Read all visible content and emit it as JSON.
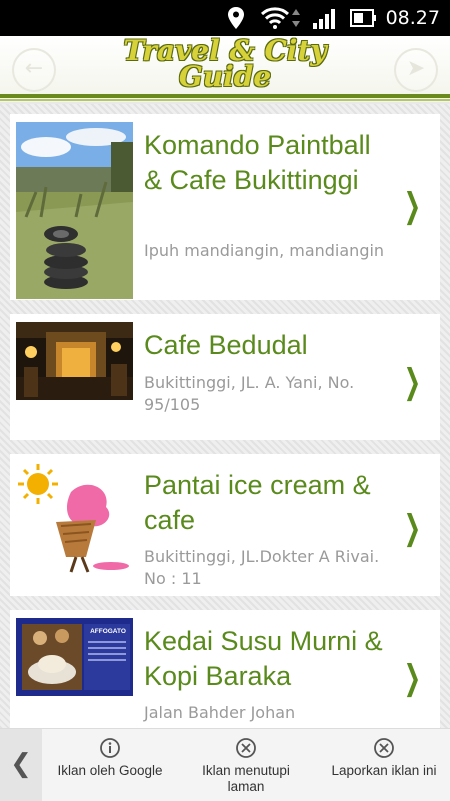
{
  "status_bar": {
    "time": "08.27"
  },
  "header": {
    "title_line1": "Travel & City",
    "title_line2": "Guide",
    "back_icon": "back-arrow-icon",
    "share_icon": "share-icon"
  },
  "places": [
    {
      "name": "Komando Paintball & Cafe Bukittinggi",
      "address": "Ipuh mandiangin, mandiangin"
    },
    {
      "name": "Cafe Bedudal",
      "address": "Bukittinggi, JL. A. Yani, No. 95/105"
    },
    {
      "name": "Pantai ice cream & cafe",
      "address": "Bukittinggi, JL.Dokter A Rivai. No : 11"
    },
    {
      "name": "Kedai Susu Murni & Kopi Baraka",
      "address": "Jalan Bahder Johan",
      "thumb_text": "AFFOGATO"
    }
  ],
  "ad_bar": {
    "items": [
      {
        "label": "Iklan oleh Google",
        "icon": "info-icon"
      },
      {
        "label": "Iklan menutupi laman",
        "icon": "close-circle-icon"
      },
      {
        "label": "Laporkan iklan ini",
        "icon": "close-circle-icon"
      }
    ]
  },
  "colors": {
    "accent_green": "#5a8a1c",
    "header_rule": "#6b8a1d"
  }
}
